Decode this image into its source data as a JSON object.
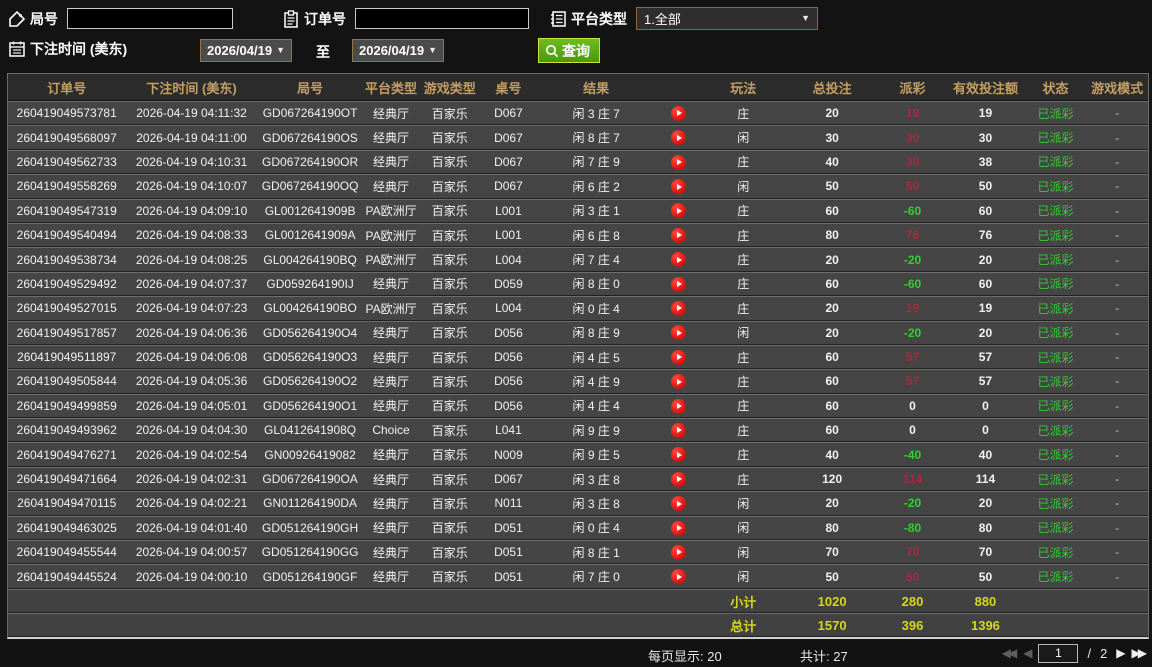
{
  "toolbar": {
    "game_no_label": "局号",
    "order_no_label": "订单号",
    "platform_label": "平台类型",
    "platform_value": "1.全部",
    "bet_time_label": "下注时间 (美东)",
    "date_from": "2026/04/19",
    "to_label": "至",
    "date_to": "2026/04/19",
    "query_label": "查询"
  },
  "icons": {
    "caret_down": "▼",
    "pager_first": "◀◀",
    "pager_prev": "◀",
    "pager_next": "▶",
    "pager_last": "▶▶"
  },
  "table": {
    "columns": [
      "订单号",
      "下注时间 (美东)",
      "局号",
      "平台类型",
      "游戏类型",
      "桌号",
      "结果",
      "",
      "玩法",
      "总投注",
      "派彩",
      "有效投注额",
      "状态",
      "游戏模式"
    ],
    "rows": [
      {
        "order": "260419049573781",
        "time": "2026-04-19 04:11:32",
        "game_no": "GD067264190OT",
        "platform": "经典厅",
        "game_type": "百家乐",
        "table_no": "D067",
        "result": "闲 3 庄 7",
        "play": "庄",
        "total_bet": "20",
        "payout": "19",
        "payout_class": "pos",
        "valid_bet": "19",
        "status": "已派彩",
        "mode": "-"
      },
      {
        "order": "260419049568097",
        "time": "2026-04-19 04:11:00",
        "game_no": "GD067264190OS",
        "platform": "经典厅",
        "game_type": "百家乐",
        "table_no": "D067",
        "result": "闲 8 庄 7",
        "play": "闲",
        "total_bet": "30",
        "payout": "30",
        "payout_class": "pos",
        "valid_bet": "30",
        "status": "已派彩",
        "mode": "-"
      },
      {
        "order": "260419049562733",
        "time": "2026-04-19 04:10:31",
        "game_no": "GD067264190OR",
        "platform": "经典厅",
        "game_type": "百家乐",
        "table_no": "D067",
        "result": "闲 7 庄 9",
        "play": "庄",
        "total_bet": "40",
        "payout": "38",
        "payout_class": "pos",
        "valid_bet": "38",
        "status": "已派彩",
        "mode": "-"
      },
      {
        "order": "260419049558269",
        "time": "2026-04-19 04:10:07",
        "game_no": "GD067264190OQ",
        "platform": "经典厅",
        "game_type": "百家乐",
        "table_no": "D067",
        "result": "闲 6 庄 2",
        "play": "闲",
        "total_bet": "50",
        "payout": "50",
        "payout_class": "pos",
        "valid_bet": "50",
        "status": "已派彩",
        "mode": "-"
      },
      {
        "order": "260419049547319",
        "time": "2026-04-19 04:09:10",
        "game_no": "GL0012641909B",
        "platform": "PA欧洲厅",
        "game_type": "百家乐",
        "table_no": "L001",
        "result": "闲 3 庄 1",
        "play": "庄",
        "total_bet": "60",
        "payout": "-60",
        "payout_class": "neg",
        "valid_bet": "60",
        "status": "已派彩",
        "mode": "-"
      },
      {
        "order": "260419049540494",
        "time": "2026-04-19 04:08:33",
        "game_no": "GL0012641909A",
        "platform": "PA欧洲厅",
        "game_type": "百家乐",
        "table_no": "L001",
        "result": "闲 6 庄 8",
        "play": "庄",
        "total_bet": "80",
        "payout": "76",
        "payout_class": "pos",
        "valid_bet": "76",
        "status": "已派彩",
        "mode": "-"
      },
      {
        "order": "260419049538734",
        "time": "2026-04-19 04:08:25",
        "game_no": "GL004264190BQ",
        "platform": "PA欧洲厅",
        "game_type": "百家乐",
        "table_no": "L004",
        "result": "闲 7 庄 4",
        "play": "庄",
        "total_bet": "20",
        "payout": "-20",
        "payout_class": "neg",
        "valid_bet": "20",
        "status": "已派彩",
        "mode": "-"
      },
      {
        "order": "260419049529492",
        "time": "2026-04-19 04:07:37",
        "game_no": "GD059264190IJ",
        "platform": "经典厅",
        "game_type": "百家乐",
        "table_no": "D059",
        "result": "闲 8 庄 0",
        "play": "庄",
        "total_bet": "60",
        "payout": "-60",
        "payout_class": "neg",
        "valid_bet": "60",
        "status": "已派彩",
        "mode": "-"
      },
      {
        "order": "260419049527015",
        "time": "2026-04-19 04:07:23",
        "game_no": "GL004264190BO",
        "platform": "PA欧洲厅",
        "game_type": "百家乐",
        "table_no": "L004",
        "result": "闲 0 庄 4",
        "play": "庄",
        "total_bet": "20",
        "payout": "19",
        "payout_class": "pos",
        "valid_bet": "19",
        "status": "已派彩",
        "mode": "-"
      },
      {
        "order": "260419049517857",
        "time": "2026-04-19 04:06:36",
        "game_no": "GD056264190O4",
        "platform": "经典厅",
        "game_type": "百家乐",
        "table_no": "D056",
        "result": "闲 8 庄 9",
        "play": "闲",
        "total_bet": "20",
        "payout": "-20",
        "payout_class": "neg",
        "valid_bet": "20",
        "status": "已派彩",
        "mode": "-"
      },
      {
        "order": "260419049511897",
        "time": "2026-04-19 04:06:08",
        "game_no": "GD056264190O3",
        "platform": "经典厅",
        "game_type": "百家乐",
        "table_no": "D056",
        "result": "闲 4 庄 5",
        "play": "庄",
        "total_bet": "60",
        "payout": "57",
        "payout_class": "pos",
        "valid_bet": "57",
        "status": "已派彩",
        "mode": "-"
      },
      {
        "order": "260419049505844",
        "time": "2026-04-19 04:05:36",
        "game_no": "GD056264190O2",
        "platform": "经典厅",
        "game_type": "百家乐",
        "table_no": "D056",
        "result": "闲 4 庄 9",
        "play": "庄",
        "total_bet": "60",
        "payout": "57",
        "payout_class": "pos",
        "valid_bet": "57",
        "status": "已派彩",
        "mode": "-"
      },
      {
        "order": "260419049499859",
        "time": "2026-04-19 04:05:01",
        "game_no": "GD056264190O1",
        "platform": "经典厅",
        "game_type": "百家乐",
        "table_no": "D056",
        "result": "闲 4 庄 4",
        "play": "庄",
        "total_bet": "60",
        "payout": "0",
        "payout_class": "zero",
        "valid_bet": "0",
        "status": "已派彩",
        "mode": "-"
      },
      {
        "order": "260419049493962",
        "time": "2026-04-19 04:04:30",
        "game_no": "GL0412641908Q",
        "platform": "Choice",
        "game_type": "百家乐",
        "table_no": "L041",
        "result": "闲 9 庄 9",
        "play": "庄",
        "total_bet": "60",
        "payout": "0",
        "payout_class": "zero",
        "valid_bet": "0",
        "status": "已派彩",
        "mode": "-"
      },
      {
        "order": "260419049476271",
        "time": "2026-04-19 04:02:54",
        "game_no": "GN00926419082",
        "platform": "经典厅",
        "game_type": "百家乐",
        "table_no": "N009",
        "result": "闲 9 庄 5",
        "play": "庄",
        "total_bet": "40",
        "payout": "-40",
        "payout_class": "neg",
        "valid_bet": "40",
        "status": "已派彩",
        "mode": "-"
      },
      {
        "order": "260419049471664",
        "time": "2026-04-19 04:02:31",
        "game_no": "GD067264190OA",
        "platform": "经典厅",
        "game_type": "百家乐",
        "table_no": "D067",
        "result": "闲 3 庄 8",
        "play": "庄",
        "total_bet": "120",
        "payout": "114",
        "payout_class": "pos",
        "valid_bet": "114",
        "status": "已派彩",
        "mode": "-"
      },
      {
        "order": "260419049470115",
        "time": "2026-04-19 04:02:21",
        "game_no": "GN011264190DA",
        "platform": "经典厅",
        "game_type": "百家乐",
        "table_no": "N011",
        "result": "闲 3 庄 8",
        "play": "闲",
        "total_bet": "20",
        "payout": "-20",
        "payout_class": "neg",
        "valid_bet": "20",
        "status": "已派彩",
        "mode": "-"
      },
      {
        "order": "260419049463025",
        "time": "2026-04-19 04:01:40",
        "game_no": "GD051264190GH",
        "platform": "经典厅",
        "game_type": "百家乐",
        "table_no": "D051",
        "result": "闲 0 庄 4",
        "play": "闲",
        "total_bet": "80",
        "payout": "-80",
        "payout_class": "neg",
        "valid_bet": "80",
        "status": "已派彩",
        "mode": "-"
      },
      {
        "order": "260419049455544",
        "time": "2026-04-19 04:00:57",
        "game_no": "GD051264190GG",
        "platform": "经典厅",
        "game_type": "百家乐",
        "table_no": "D051",
        "result": "闲 8 庄 1",
        "play": "闲",
        "total_bet": "70",
        "payout": "70",
        "payout_class": "pos",
        "valid_bet": "70",
        "status": "已派彩",
        "mode": "-"
      },
      {
        "order": "260419049445524",
        "time": "2026-04-19 04:00:10",
        "game_no": "GD051264190GF",
        "platform": "经典厅",
        "game_type": "百家乐",
        "table_no": "D051",
        "result": "闲 7 庄 0",
        "play": "闲",
        "total_bet": "50",
        "payout": "50",
        "payout_class": "pos",
        "valid_bet": "50",
        "status": "已派彩",
        "mode": "-"
      }
    ],
    "subtotal": {
      "label": "小计",
      "total_bet": "1020",
      "payout": "280",
      "valid_bet": "880"
    },
    "grand_total": {
      "label": "总计",
      "total_bet": "1570",
      "payout": "396",
      "valid_bet": "1396"
    }
  },
  "footer": {
    "per_page_text": "每页显示: 20",
    "total_count_text": "共计: 27",
    "page": "1",
    "page_sep": "/",
    "total_pages": "2"
  },
  "colors": {
    "header_text": "#c59f62",
    "win_payout": "#a8293e",
    "loss_payout": "#30d030",
    "status_paid": "#30d030",
    "totals_yellow": "#d6d71d",
    "query_button_green": "#4b980f"
  }
}
